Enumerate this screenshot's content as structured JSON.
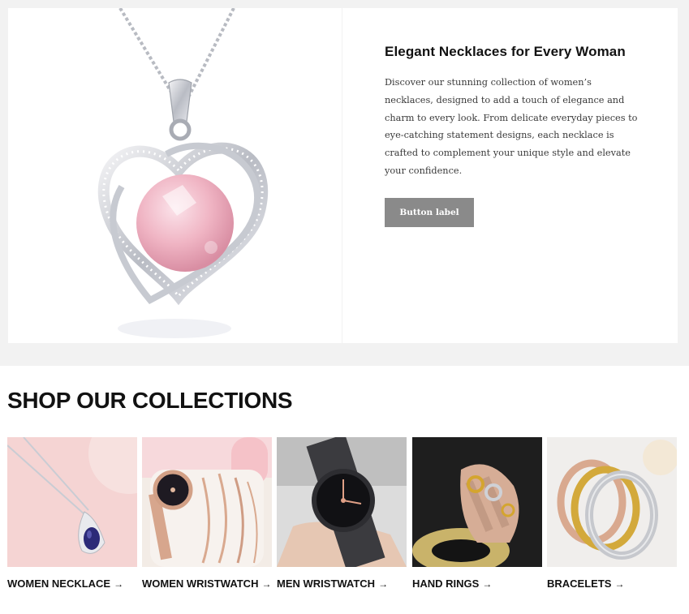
{
  "feature": {
    "heading": "Elegant Necklaces for Every Woman",
    "body": "Discover our stunning collection of women’s necklaces, designed to add a touch of elegance and charm to every look. From delicate everyday pieces to eye-catching statement designs, each necklace is crafted to complement your unique style and elevate your confidence.",
    "button_label": "Button label",
    "image": "pink-heart-pendant-necklace"
  },
  "collections": {
    "title": "SHOP OUR COLLECTIONS",
    "arrow": "→",
    "items": [
      {
        "label": "WOMEN NECKLACE",
        "image": "blue-gem-pendant-necklace"
      },
      {
        "label": "WOMEN WRISTWATCH",
        "image": "rose-gold-watch-and-bracelets"
      },
      {
        "label": "MEN WRISTWATCH",
        "image": "black-mesh-watch-on-wrist"
      },
      {
        "label": "HAND RINGS",
        "image": "gold-rings-on-hand"
      },
      {
        "label": "BRACELETS",
        "image": "stacked-bangle-bracelets"
      }
    ]
  },
  "colors": {
    "band_background": "#f2f2f2",
    "button_background": "#8a8a8a",
    "text_dark": "#121212"
  }
}
